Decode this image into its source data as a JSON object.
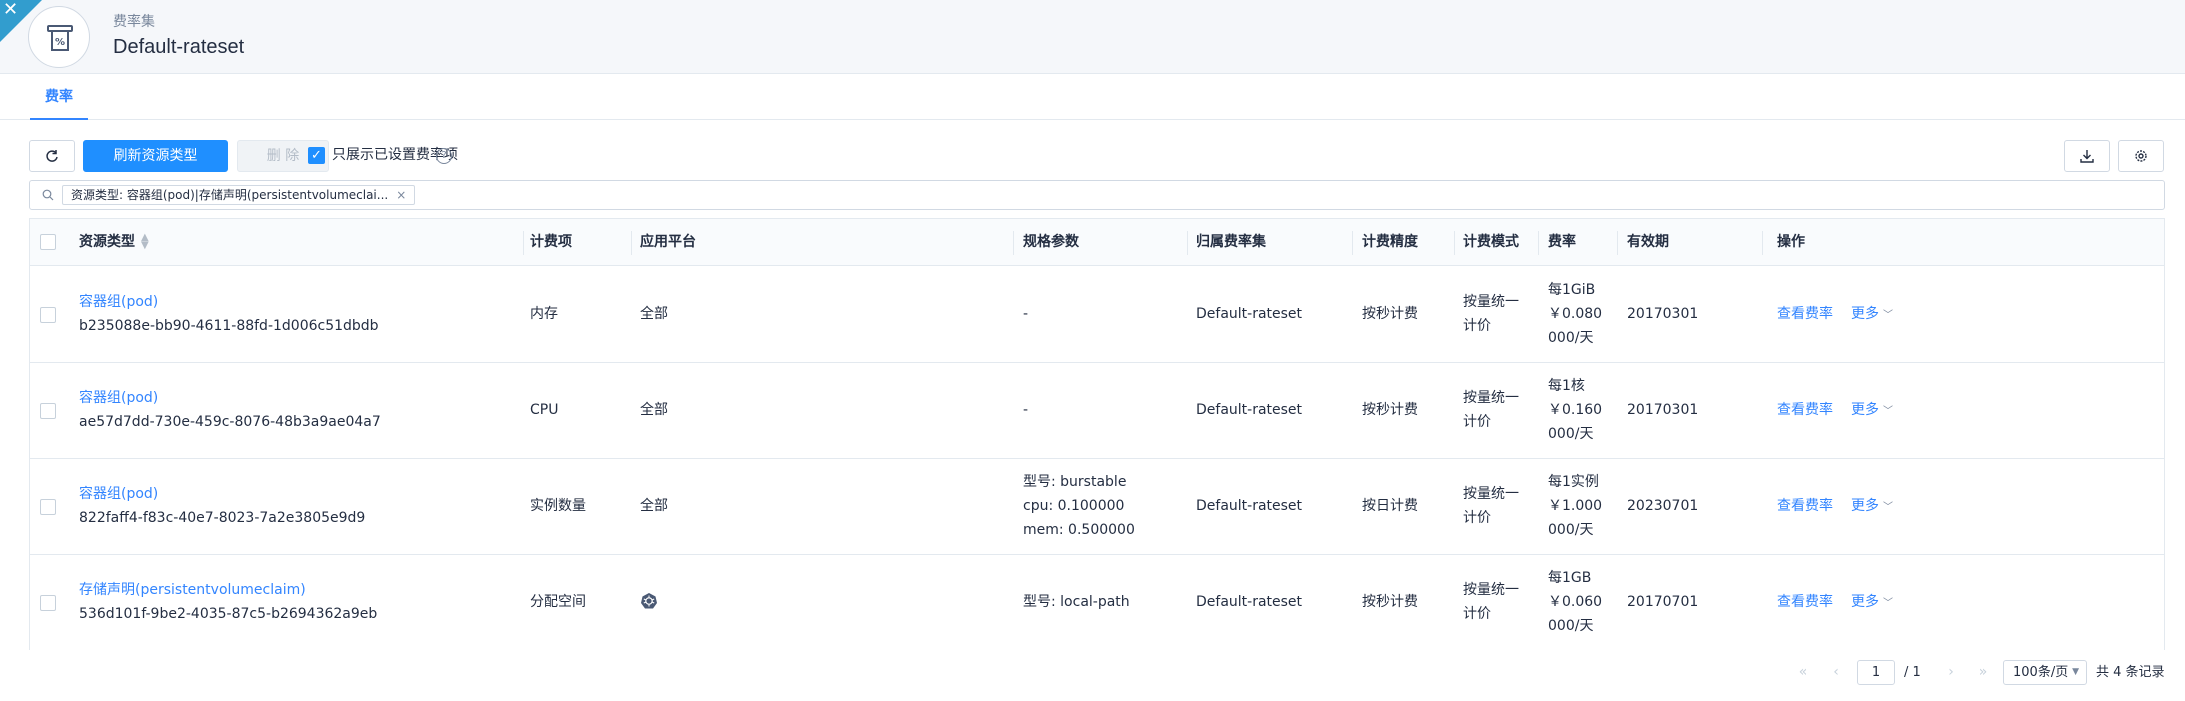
{
  "header": {
    "subtitle": "费率集",
    "title": "Default-rateset",
    "close_label": "✕"
  },
  "tabs": [
    {
      "label": "费率"
    }
  ],
  "toolbar": {
    "refresh_types_label": "刷新资源类型",
    "delete_label": "删 除",
    "only_set_label": "只展示已设置费率项",
    "only_set_checked": true
  },
  "filter": {
    "tag_text": "资源类型: 容器组(pod)|存储声明(persistentvolumeclai...",
    "tag_close": "×"
  },
  "table": {
    "columns": [
      "资源类型",
      "计费项",
      "应用平台",
      "规格参数",
      "归属费率集",
      "计费精度",
      "计费模式",
      "费率",
      "有效期",
      "操作"
    ],
    "rows": [
      {
        "type_name": "容器组(pod)",
        "type_id": "b235088e-bb90-4611-88fd-1d006c51dbdb",
        "item": "内存",
        "platform": "全部",
        "spec": [
          "-"
        ],
        "rateset": "Default-rateset",
        "precision": "按秒计费",
        "mode": [
          "按量统一",
          "计价"
        ],
        "rate": [
          "每1GiB",
          "￥0.080",
          "000/天"
        ],
        "valid": "20170301",
        "action_view": "查看费率",
        "action_more": "更多"
      },
      {
        "type_name": "容器组(pod)",
        "type_id": "ae57d7dd-730e-459c-8076-48b3a9ae04a7",
        "item": "CPU",
        "platform": "全部",
        "spec": [
          "-"
        ],
        "rateset": "Default-rateset",
        "precision": "按秒计费",
        "mode": [
          "按量统一",
          "计价"
        ],
        "rate": [
          "每1核",
          "￥0.160",
          "000/天"
        ],
        "valid": "20170301",
        "action_view": "查看费率",
        "action_more": "更多"
      },
      {
        "type_name": "容器组(pod)",
        "type_id": "822faff4-f83c-40e7-8023-7a2e3805e9d9",
        "item": "实例数量",
        "platform": "全部",
        "spec": [
          "型号: burstable",
          "cpu: 0.100000",
          "mem: 0.500000"
        ],
        "rateset": "Default-rateset",
        "precision": "按日计费",
        "mode": [
          "按量统一",
          "计价"
        ],
        "rate": [
          "每1实例",
          "￥1.000",
          "000/天"
        ],
        "valid": "20230701",
        "action_view": "查看费率",
        "action_more": "更多"
      },
      {
        "type_name": "存储声明(persistentvolumeclaim)",
        "type_id": "536d101f-9be2-4035-87c5-b2694362a9eb",
        "item": "分配空间",
        "platform": "",
        "platform_icon": "kubernetes-icon",
        "spec": [
          "型号: local-path"
        ],
        "rateset": "Default-rateset",
        "precision": "按秒计费",
        "mode": [
          "按量统一",
          "计价"
        ],
        "rate": [
          "每1GB",
          "￥0.060",
          "000/天"
        ],
        "valid": "20170701",
        "action_view": "查看费率",
        "action_more": "更多"
      }
    ]
  },
  "pagination": {
    "current_page": "1",
    "total_pages": "/ 1",
    "page_size": "100条/页",
    "total_records": "共 4 条记录"
  },
  "colors": {
    "primary": "#1f8fff",
    "link": "#3385ff",
    "corner": "#329dce"
  }
}
